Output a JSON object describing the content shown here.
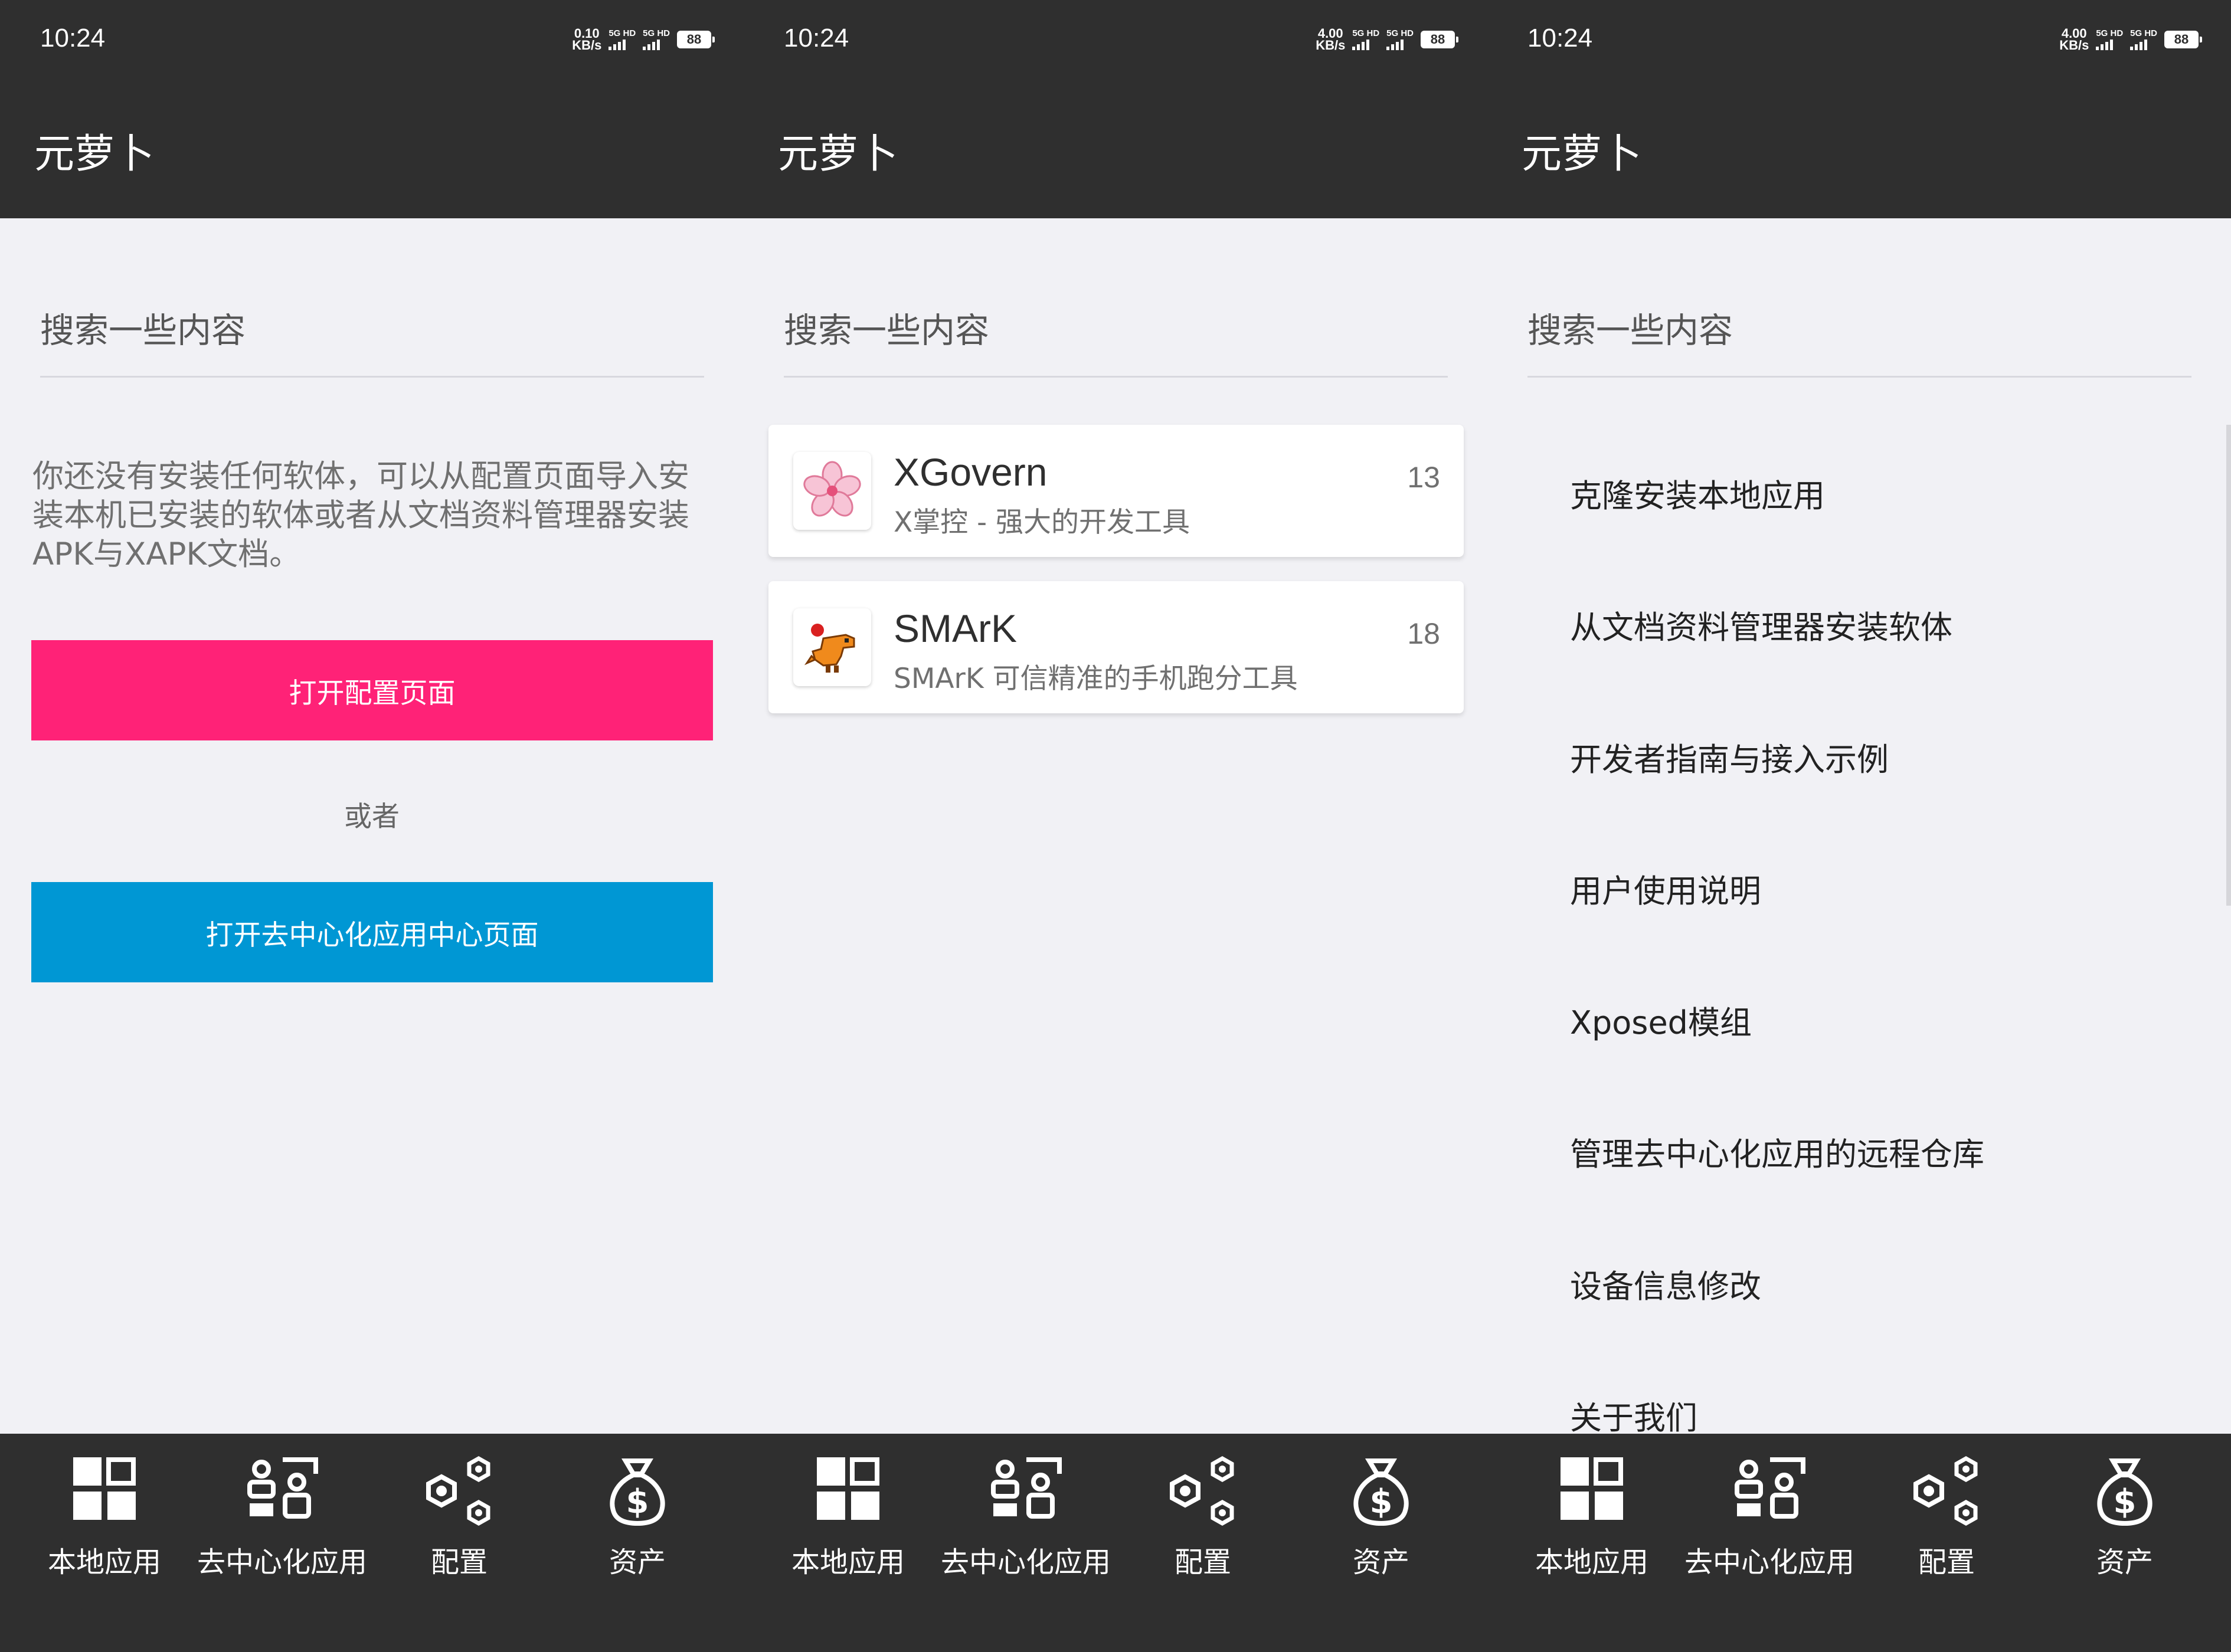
{
  "screens": [
    {
      "status": {
        "time": "10:24",
        "speed_value": "0.10",
        "speed_unit": "KB/s",
        "sig1_label": "5G HD",
        "sig2_label": "5G HD",
        "battery": "88"
      },
      "app_title": "元萝卜",
      "search_placeholder": "搜索一些内容",
      "empty_message": "你还没有安装任何软体，可以从配置页面导入安装本机已安装的软体或者从文档资料管理器安装APK与XAPK文档。",
      "open_config_button": "打开配置页面",
      "or_text": "或者",
      "open_decentral_button": "打开去中心化应用中心页面"
    },
    {
      "status": {
        "time": "10:24",
        "speed_value": "4.00",
        "speed_unit": "KB/s",
        "sig1_label": "5G HD",
        "sig2_label": "5G HD",
        "battery": "88"
      },
      "app_title": "元萝卜",
      "search_placeholder": "搜索一些内容",
      "apps": [
        {
          "name": "XGovern",
          "description": "X掌控 - 强大的开发工具",
          "count": "13",
          "icon": "sakura-icon"
        },
        {
          "name": "SMArK",
          "description": "SMArK 可信精准的手机跑分工具",
          "count": "18",
          "icon": "dinosaur-icon"
        }
      ]
    },
    {
      "status": {
        "time": "10:24",
        "speed_value": "4.00",
        "speed_unit": "KB/s",
        "sig1_label": "5G HD",
        "sig2_label": "5G HD",
        "battery": "88"
      },
      "app_title": "元萝卜",
      "search_placeholder": "搜索一些内容",
      "menu": [
        "克隆安装本地应用",
        "从文档资料管理器安装软体",
        "开发者指南与接入示例",
        "用户使用说明",
        "Xposed模组",
        "管理去中心化应用的远程仓库",
        "设备信息修改",
        "关于我们"
      ]
    }
  ],
  "bottom_nav": [
    {
      "label": "本地应用",
      "icon": "grid-icon"
    },
    {
      "label": "去中心化应用",
      "icon": "people-icon"
    },
    {
      "label": "配置",
      "icon": "hex-nodes-icon"
    },
    {
      "label": "资产",
      "icon": "money-bag-icon"
    }
  ],
  "colors": {
    "bar_bg": "#2f2f2f",
    "page_bg": "#f1f1f5",
    "pink_button": "#ff2277",
    "blue_button": "#0097d4"
  }
}
